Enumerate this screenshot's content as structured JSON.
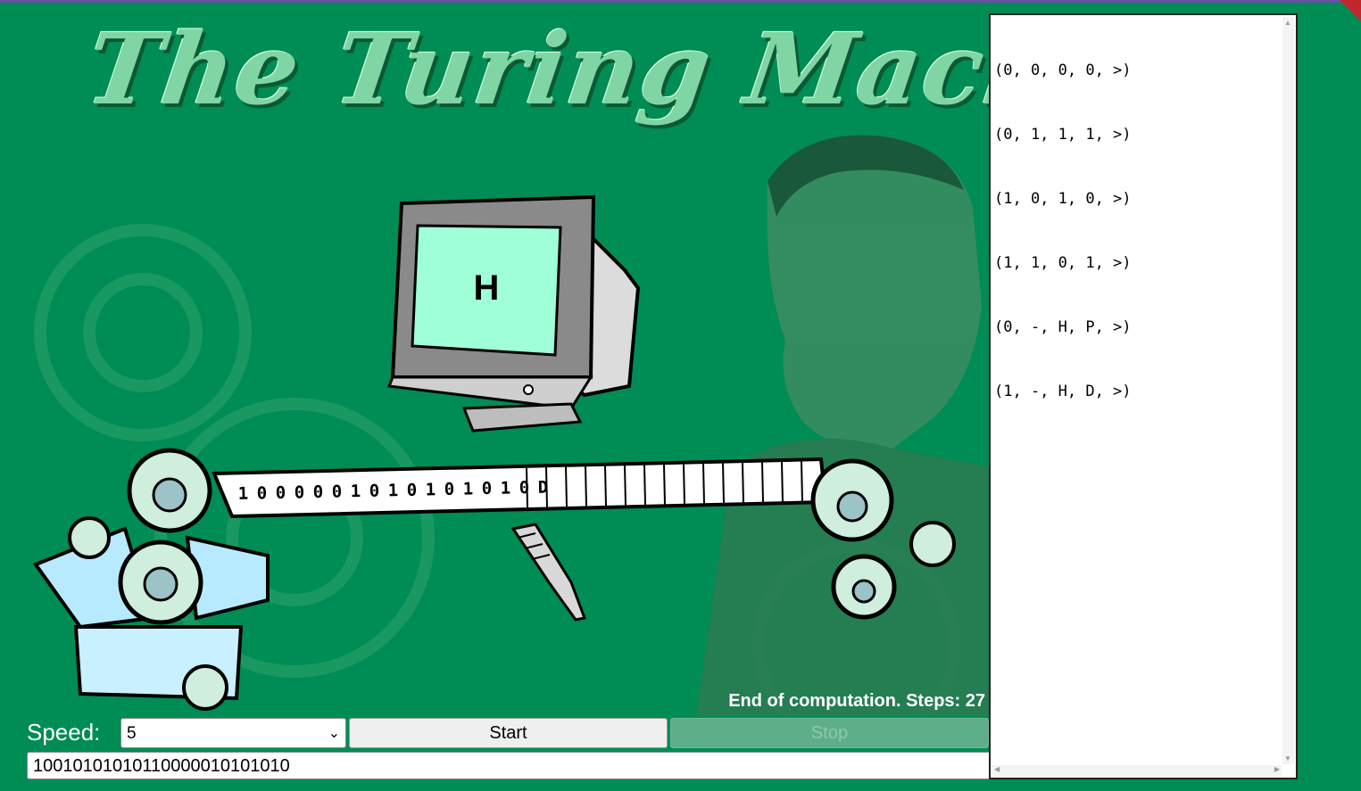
{
  "title": "The Turing Machine",
  "machine": {
    "current_state": "H",
    "tape_cells": [
      "1",
      "0",
      "0",
      "0",
      "0",
      "0",
      "1",
      "0",
      "1",
      "0",
      "1",
      "0",
      "1",
      "0",
      "1",
      "0",
      "D"
    ]
  },
  "status": "End of computation. Steps: 27",
  "controls": {
    "speed_label": "Speed:",
    "speed_value": "5",
    "start_label": "Start",
    "stop_label": "Stop",
    "tape_input_value": "10010101010110000010101010"
  },
  "rules": [
    "(0, 0, 0, 0, >)",
    "(0, 1, 1, 1, >)",
    "(1, 0, 1, 0, >)",
    "(1, 1, 0, 1, >)",
    "(0, -, H, P, >)",
    "(1, -, H, D, >)"
  ],
  "colors": {
    "background": "#008c55",
    "screen": "#9fffd8",
    "button_disabled": "#5eae8a"
  }
}
